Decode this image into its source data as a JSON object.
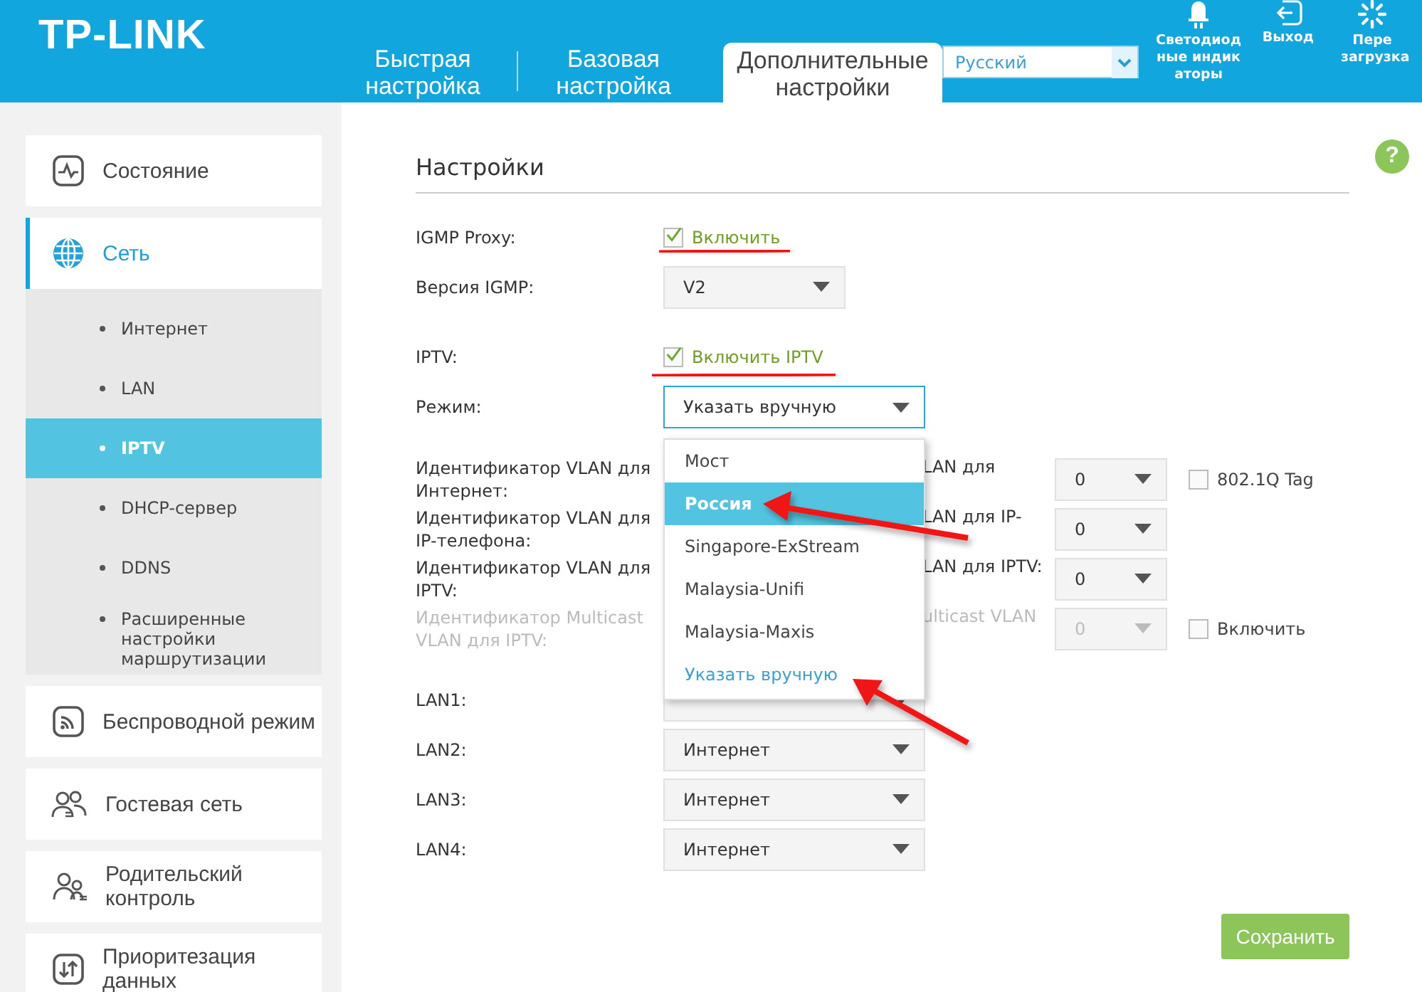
{
  "header": {
    "logo": "TP-LINK",
    "tabs": [
      {
        "label": "Быстрая настройка",
        "selected": false
      },
      {
        "label": "Базовая настройка",
        "selected": false
      },
      {
        "label": "Дополнительные настройки",
        "selected": true
      }
    ],
    "language": "Русский",
    "actions": [
      {
        "kind": "led",
        "label": "Светодиодные индикаторы"
      },
      {
        "kind": "logout",
        "label": "Выход"
      },
      {
        "kind": "reboot",
        "label": "Пере загрузка"
      }
    ]
  },
  "sidebar": {
    "items": [
      {
        "kind": "status",
        "label": "Состояние",
        "selected": false
      },
      {
        "kind": "network",
        "label": "Сеть",
        "selected": true,
        "expanded": true,
        "children": [
          {
            "label": "Интернет",
            "selected": false
          },
          {
            "label": "LAN",
            "selected": false
          },
          {
            "label": "IPTV",
            "selected": true
          },
          {
            "label": "DHCP-сервер",
            "selected": false
          },
          {
            "label": "DDNS",
            "selected": false
          },
          {
            "label": "Расширенные настройки маршрутизации",
            "selected": false
          }
        ]
      },
      {
        "kind": "wireless",
        "label": "Беспроводной режим",
        "selected": false
      },
      {
        "kind": "guest",
        "label": "Гостевая сеть",
        "selected": false
      },
      {
        "kind": "parental",
        "label": "Родительский контроль",
        "selected": false
      },
      {
        "kind": "priority",
        "label": "Приоритезация данных",
        "selected": false
      }
    ]
  },
  "help_button": "?",
  "form": {
    "title": "Настройки",
    "rows": [
      {
        "kind": "checkbox",
        "label": "IGMP Proxy:",
        "option": "Включить",
        "checked": true
      },
      {
        "kind": "select",
        "label": "Версия IGMP:",
        "value": "V2",
        "wide": false,
        "focused": false
      },
      {
        "kind": "checkbox",
        "label": "IPTV:",
        "option": "Включить IPTV",
        "checked": true
      },
      {
        "kind": "select",
        "label": "Режим:",
        "value": "Указать вручную",
        "wide": true,
        "focused": true
      }
    ],
    "vlan_rows": [
      {
        "label": "Идентификатор VLAN для Интернет:",
        "label_2": "LAN для",
        "value": "0",
        "disabled": false,
        "option": "802.1Q Tag",
        "checked": false
      },
      {
        "label": "Идентификатор VLAN для IP-телефона:",
        "label_2": "LAN для IP-",
        "value": "0",
        "disabled": false
      },
      {
        "label": "Идентификатор VLAN для IPTV:",
        "label_2": "LAN для IPTV:",
        "value": "0",
        "disabled": false
      },
      {
        "label": "Идентификатор Multicast VLAN для IPTV:",
        "label_2": "ulticast VLAN",
        "value": "0",
        "disabled": true,
        "option": "Включить",
        "checked": false
      }
    ],
    "lan_rows": [
      {
        "label": "LAN1:"
      },
      {
        "label": "LAN2:",
        "value": "Интернет"
      },
      {
        "label": "LAN3:",
        "value": "Интернет"
      },
      {
        "label": "LAN4:",
        "value": "Интернет"
      }
    ],
    "save_button": "Сохранить"
  },
  "dropdown": {
    "options": [
      {
        "label": "Мост",
        "highlighted": false,
        "selected": false
      },
      {
        "label": "Россия",
        "highlighted": true,
        "selected": false
      },
      {
        "label": "Singapore-ExStream",
        "highlighted": false,
        "selected": false
      },
      {
        "label": "Malaysia-Unifi",
        "highlighted": false,
        "selected": false
      },
      {
        "label": "Malaysia-Maxis",
        "highlighted": false,
        "selected": false
      },
      {
        "label": "Указать вручную",
        "highlighted": false,
        "selected": true
      }
    ]
  }
}
